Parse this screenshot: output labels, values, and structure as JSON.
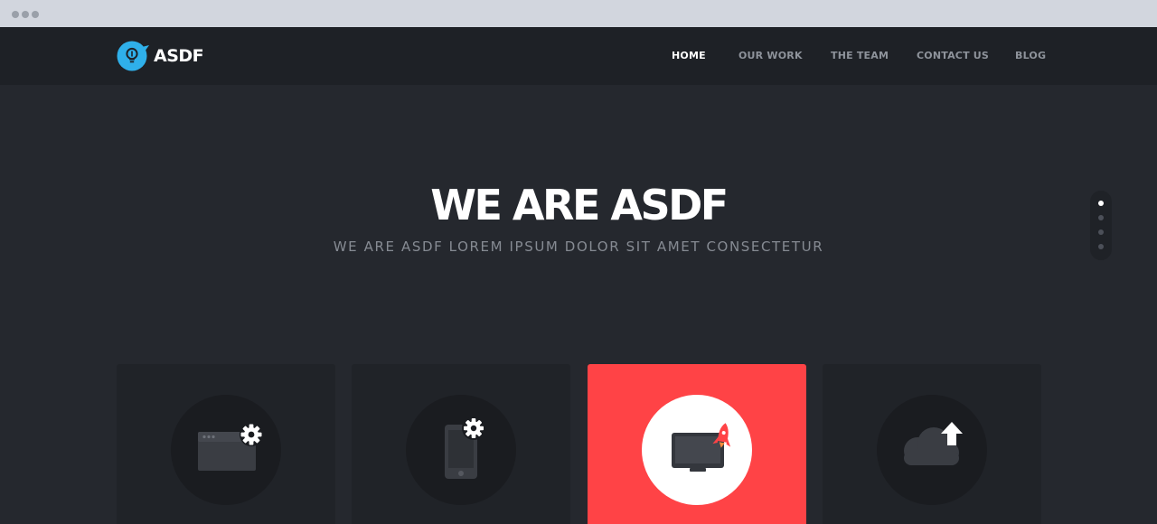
{
  "brand": {
    "name": "ASDF",
    "accent": "#2fb0ea"
  },
  "nav": {
    "items": [
      {
        "label": "HOME",
        "active": true
      },
      {
        "label": "OUR WORK",
        "active": false
      },
      {
        "label": "THE TEAM",
        "active": false
      },
      {
        "label": "CONTACT US",
        "active": false
      },
      {
        "label": "BLOG",
        "active": false
      }
    ]
  },
  "hero": {
    "title": "WE ARE ASDF",
    "subtitle": "WE ARE ASDF LOREM IPSUM DOLOR SIT AMET CONSECTETUR"
  },
  "pager": {
    "count": 4,
    "active_index": 0
  },
  "services": [
    {
      "icon": "browser-settings-icon",
      "highlighted": false
    },
    {
      "icon": "mobile-settings-icon",
      "highlighted": false
    },
    {
      "icon": "monitor-rocket-icon",
      "highlighted": true
    },
    {
      "icon": "cloud-upload-icon",
      "highlighted": false
    }
  ],
  "colors": {
    "background": "#25282e",
    "navbar": "#1e2126",
    "card": "#202328",
    "highlight": "#ff4346",
    "icon_gray": "#3a3d43"
  }
}
